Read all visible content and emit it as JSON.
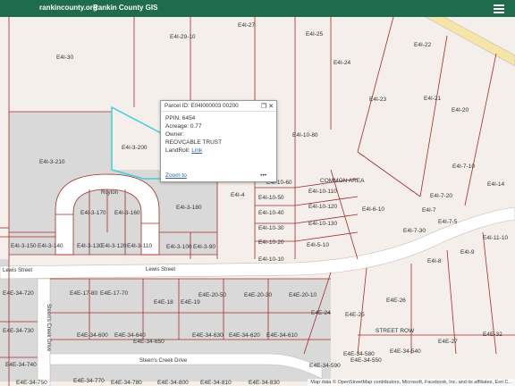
{
  "header": {
    "link_text": "rankincounty.org",
    "title": "Rankin County GIS"
  },
  "popup": {
    "title": "Parcel ID: E04I000003 00200",
    "ppin": "PPIN: 6454",
    "acreage": "Acreage: 0.77",
    "owner_label": "Owner:",
    "owner": "REOVCABLE TRUST",
    "landroll": "LandRoll: ",
    "link": "Link",
    "zoom": "Zoom to",
    "more": "•••",
    "window_buttons": "❐ ✕"
  },
  "streets": [
    "Lewis Street",
    "Lewis Street",
    "Steen's Creek Drive",
    "Steen's Creek Drive",
    "Royton"
  ],
  "area_labels": [
    "COMMON AREA",
    "STREET ROW"
  ],
  "parcels": [
    "E4I-29-10",
    "E4I-27",
    "E4I-25",
    "E4I-22",
    "E4I-30",
    "E4I-24",
    "E4I-23",
    "E4I-21",
    "E4I-20",
    "E4I-10-80",
    "E4I-3-200",
    "E4I-3-210",
    "E4I-3-170",
    "E4I-3-160",
    "E4I-3-180",
    "E4I-10-60",
    "E4I-10-50",
    "E4I-10-40",
    "E4I-10-30",
    "E4I-10-20",
    "E4I-10-10",
    "E4I-10-110",
    "E4I-10-120",
    "E4I-10-130",
    "E4I-5-10",
    "E4I-6-10",
    "E4I-7-10",
    "E4I-7-20",
    "E4I-7-30",
    "E4I-4",
    "E4I-3-150",
    "E4I-3-140",
    "E4I-3-130",
    "E4I-3-120",
    "E4I-3-110",
    "E4I-3-100",
    "E4I-3-90",
    "E4I-7",
    "E4I-8",
    "E4I-9",
    "E4I-11-10",
    "E4I-14",
    "E4I-7-5",
    "E4E-34-720",
    "E4E-17-80",
    "E4E-17-70",
    "E4E-18",
    "E4E-19",
    "E4E-20-50",
    "E4E-20-30",
    "E4E-20-10",
    "E4E-24",
    "E4E-25",
    "E4E-26",
    "E4E-27",
    "E4E-32",
    "E4E-34-730",
    "E4E-34-600",
    "E4E-34-640",
    "E4E-34-650",
    "E4E-34-630",
    "E4E-34-620",
    "E4E-34-610",
    "E4E-34-740",
    "E4E-34-750",
    "E4E-34-770",
    "E4E-34-780",
    "E4E-34-800",
    "E4E-34-810",
    "E4E-34-830",
    "E4E-34-590",
    "E4E-34-580",
    "E4E-34-550",
    "E4E-34-540"
  ],
  "attribution": "Map data © OpenStreetMap contributors, Microsoft, Facebook, Inc. and its affiliates, Esri C...",
  "colors": {
    "header": "#1f6b4e",
    "parcel_line": "#a52a2a",
    "selected": "#3fd0d8",
    "road": "#ffffff",
    "shaded": "#d9d9d9"
  }
}
